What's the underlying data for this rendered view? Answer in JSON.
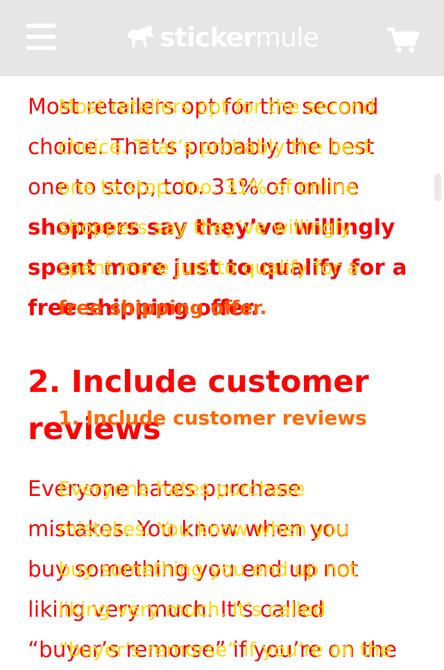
{
  "header": {
    "logo_main": "sticker",
    "logo_thin": "mule",
    "menu_icon": "hamburger-menu-icon",
    "cart_icon": "shopping-cart-icon",
    "background": "#e6e6e6"
  },
  "article_red": {
    "para1": [
      "Most retailers opt for the second",
      "choice. That’s probably the best",
      "one to stop, too. 31% of online",
      "shoppers say they’ve willingly",
      "spent more just to qualify for a",
      "free shipping offer."
    ],
    "heading": [
      "2. Include customer",
      "reviews"
    ],
    "para2": [
      "Everyone hates purchase",
      "mistakes. You know when you",
      "buy something you end up not",
      "liking very much. It’s called",
      "“buyer’s remorse” if you’re on the"
    ],
    "color": "#ff0000"
  },
  "article_yellow": {
    "para1": [
      "Most retailers opt for the second",
      "choice. That’s probably the best",
      "one to stop, too. 31% of online",
      "shoppers say they’ve willingly",
      "spent more just to qualify for a",
      "free shipping offer."
    ],
    "subheading": "1. Include customer reviews",
    "para2": [
      "Everyone hates purchase",
      "mistakes. You know when you",
      "buy something you end up not",
      "liking very much. It’s called",
      "“buyer’s remorse” if you’re on the"
    ],
    "color": "#ffd800"
  }
}
